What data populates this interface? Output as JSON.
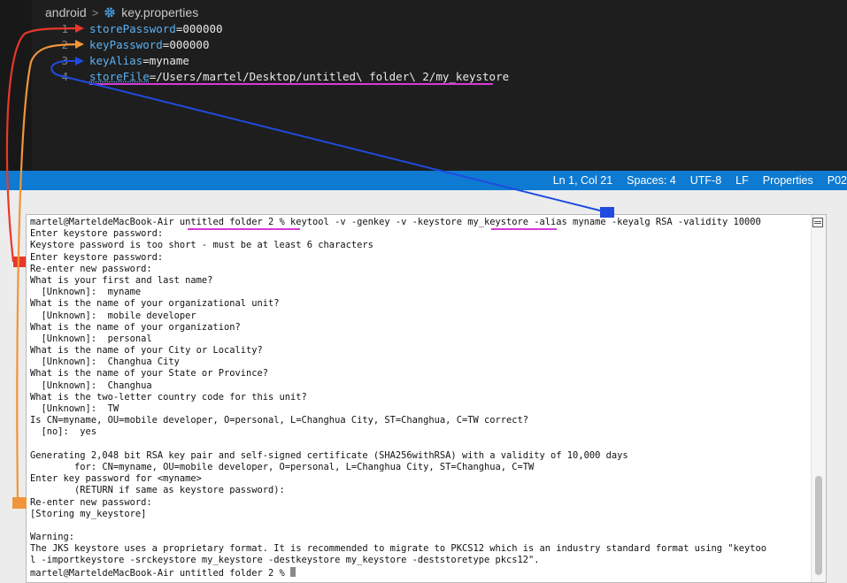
{
  "editor": {
    "breadcrumb": {
      "folder": "android",
      "separator": ">",
      "file": "key.properties",
      "file_icon": "gear-icon"
    },
    "lines": [
      {
        "number": "1",
        "key": "storePassword",
        "value": "=000000"
      },
      {
        "number": "2",
        "key": "keyPassword",
        "value": "=000000"
      },
      {
        "number": "3",
        "key": "keyAlias",
        "value": "=myname"
      },
      {
        "number": "4",
        "key": "storeFile",
        "value": "=/Users/martel/Desktop/untitled\\ folder\\ 2/my_keystore"
      }
    ]
  },
  "status_bar": {
    "position": "Ln 1, Col 21",
    "spaces": "Spaces: 4",
    "encoding": "UTF-8",
    "eol": "LF",
    "language": "Properties",
    "extra": "P02"
  },
  "terminal": {
    "lines": [
      "martel@MarteldeMacBook-Air untitled folder 2 % keytool -v -genkey -v -keystore my_keystore -alias myname -keyalg RSA -validity 10000",
      "Enter keystore password:",
      "Keystore password is too short - must be at least 6 characters",
      "Enter keystore password:",
      "Re-enter new password:",
      "What is your first and last name?",
      "  [Unknown]:  myname",
      "What is the name of your organizational unit?",
      "  [Unknown]:  mobile developer",
      "What is the name of your organization?",
      "  [Unknown]:  personal",
      "What is the name of your City or Locality?",
      "  [Unknown]:  Changhua City",
      "What is the name of your State or Province?",
      "  [Unknown]:  Changhua",
      "What is the two-letter country code for this unit?",
      "  [Unknown]:  TW",
      "Is CN=myname, OU=mobile developer, O=personal, L=Changhua City, ST=Changhua, C=TW correct?",
      "  [no]:  yes",
      "",
      "Generating 2,048 bit RSA key pair and self-signed certificate (SHA256withRSA) with a validity of 10,000 days",
      "        for: CN=myname, OU=mobile developer, O=personal, L=Changhua City, ST=Changhua, C=TW",
      "Enter key password for <myname>",
      "        (RETURN if same as keystore password):",
      "Re-enter new password:",
      "[Storing my_keystore]",
      "",
      "Warning:",
      "The JKS keystore uses a proprietary format. It is recommended to migrate to PKCS12 which is an industry standard format using \"keytoo",
      "l -importkeystore -srckeystore my_keystore -destkeystore my_keystore -deststoretype pkcs12\".",
      "martel@MarteldeMacBook-Air untitled folder 2 %"
    ]
  },
  "annotations": {
    "colors": {
      "red": "#e8382a",
      "orange": "#f0953a",
      "blue": "#1f4be0",
      "magenta": "#d63ad6"
    }
  }
}
